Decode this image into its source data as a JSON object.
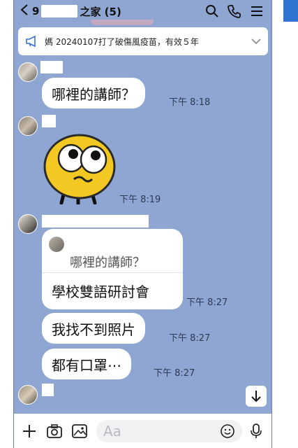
{
  "header": {
    "back_count": "9",
    "group_name": "之家 (5)"
  },
  "announcement": {
    "text": "媽 20240107打了破傷風疫苗，有效５年"
  },
  "messages": [
    {
      "text": "哪裡的講師？",
      "time": "下午 8:18"
    },
    {
      "time": "下午 8:19"
    },
    {
      "quoted_text": "哪裡的講師？",
      "text": "學校雙語研討會",
      "time": "下午 8:27"
    },
    {
      "text": "我找不到照片",
      "time": "下午 8:27"
    },
    {
      "text": "都有口罩⋯",
      "time": "下午 8:27"
    }
  ],
  "input": {
    "placeholder": "Aa"
  },
  "icons": [
    "chevron-left-icon",
    "search-icon",
    "phone-icon",
    "menu-icon",
    "megaphone-icon",
    "chevron-down-icon",
    "plus-icon",
    "camera-icon",
    "image-icon",
    "emoji-icon",
    "microphone-icon",
    "arrow-down-icon"
  ],
  "colors": {
    "chat_background": "#8fa6d3",
    "bubble": "#ffffff",
    "accent_blue": "#2f74d0"
  }
}
